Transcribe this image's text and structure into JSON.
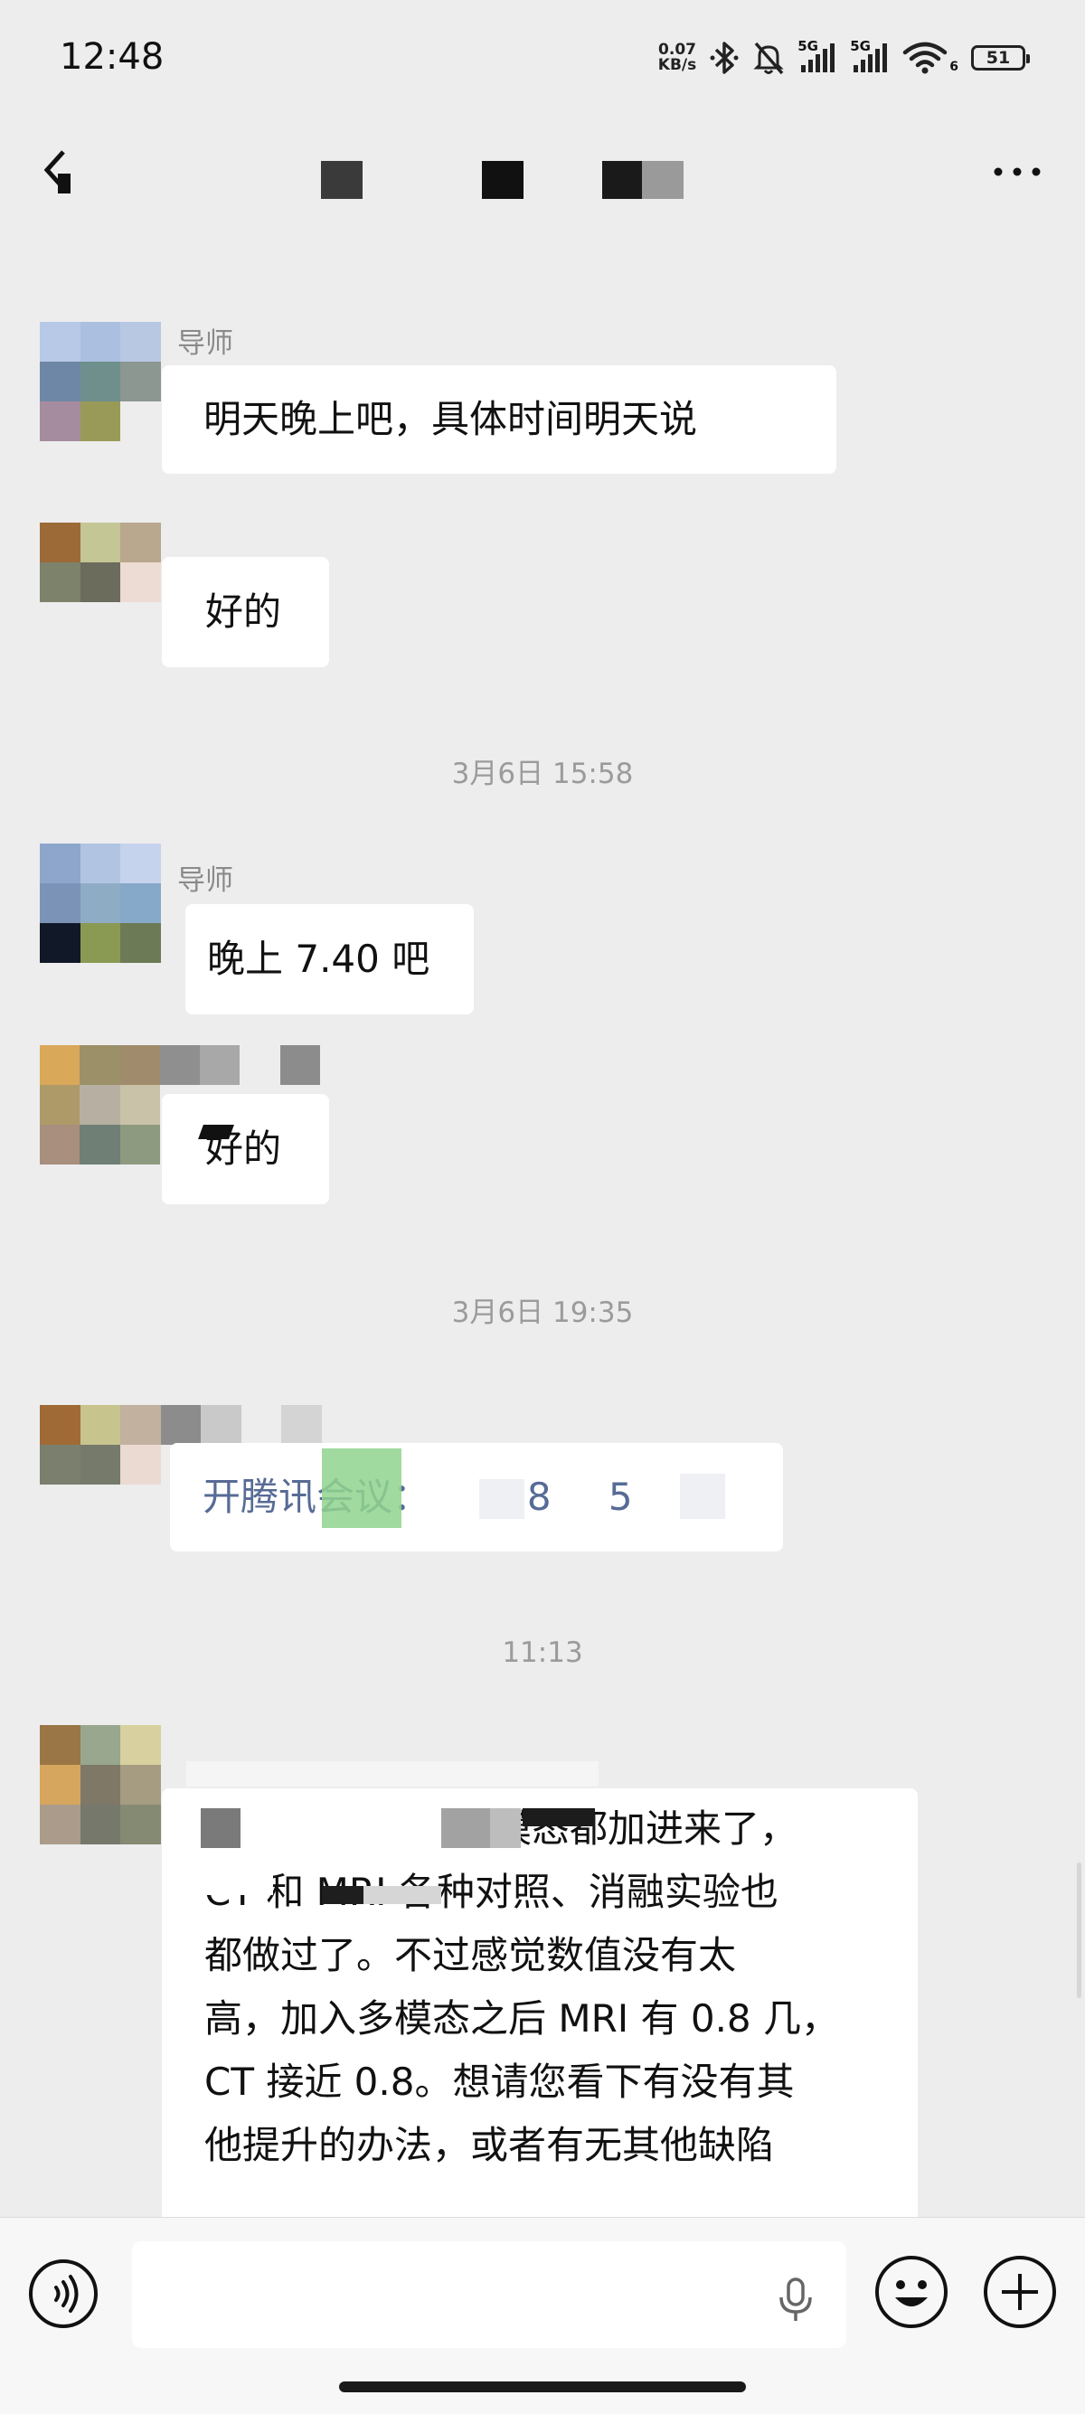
{
  "status_bar": {
    "time": "12:48",
    "net_speed_value": "0.07",
    "net_speed_unit": "KB/s",
    "signal1_label": "5G",
    "signal2_label": "5G",
    "wifi_label": "6",
    "battery": "51"
  },
  "nav": {
    "back_icon": "chevron-left-icon",
    "more_icon": "more-dots-icon"
  },
  "messages": [
    {
      "sender": "导师",
      "text": "明天晚上吧，具体时间明天说"
    },
    {
      "text": "好的"
    },
    {
      "timestamp": "3月6日 15:58"
    },
    {
      "sender": "导师",
      "text": "晚上 7.40 吧"
    },
    {
      "text": "好的"
    },
    {
      "timestamp": "3月6日 19:35"
    },
    {
      "text_prefix": "开腾讯会议：",
      "text_number": "488",
      "text_suffix": "5"
    },
    {
      "timestamp": "11:13"
    },
    {
      "lines": [
        "模态都加进来了，",
        "CT 和 MRI 各种对照、消融实验也",
        "都做过了。不过感觉数值没有太",
        "高，加入多模态之后 MRI 有 0.8 几，",
        "CT 接近 0.8。想请您看下有没有其",
        "他提升的办法，或者有无其他缺陷"
      ]
    }
  ],
  "input_bar": {
    "placeholder": "",
    "voice_icon": "voice-mode-icon",
    "mic_icon": "microphone-icon",
    "emoji_icon": "emoji-icon",
    "plus_icon": "plus-circle-icon"
  },
  "colors": {
    "background": "#ededed",
    "bubble": "#ffffff",
    "link_text": "#576b95",
    "timestamp": "#9b9b9b"
  }
}
